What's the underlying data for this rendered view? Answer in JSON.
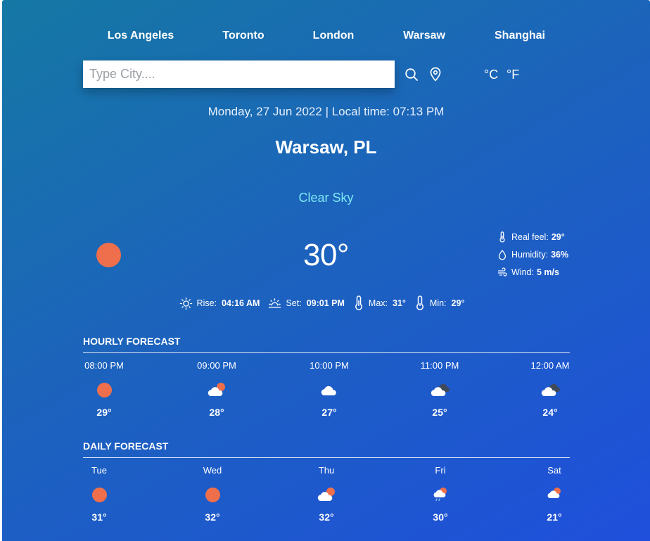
{
  "cities": [
    "Los Angeles",
    "Toronto",
    "London",
    "Warsaw",
    "Shanghai"
  ],
  "search": {
    "placeholder": "Type City....",
    "value": ""
  },
  "icons": {
    "search": "search-icon",
    "location": "location-pin-icon"
  },
  "units": {
    "celsius": "°C",
    "fahrenheit": "°F"
  },
  "datetime": "Monday, 27 Jun 2022 | Local time: 07:13 PM",
  "location": "Warsaw, PL",
  "condition": "Clear Sky",
  "current": {
    "temperature": "30°",
    "real_feel_label": "Real feel:",
    "real_feel": "29°",
    "humidity_label": "Humidity:",
    "humidity": "36%",
    "wind_label": "Wind:",
    "wind": "5 m/s"
  },
  "sun": {
    "rise_label": "Rise:",
    "rise": "04:16 AM",
    "set_label": "Set:",
    "set": "09:01 PM",
    "max_label": "Max:",
    "max": "31°",
    "min_label": "Min:",
    "min": "29°"
  },
  "hourly": {
    "title": "HOURLY FORECAST",
    "items": [
      {
        "time": "08:00 PM",
        "icon": "sun-icon",
        "temp": "29°"
      },
      {
        "time": "09:00 PM",
        "icon": "cloud-sun-icon",
        "temp": "28°"
      },
      {
        "time": "10:00 PM",
        "icon": "cloud-icon",
        "temp": "27°"
      },
      {
        "time": "11:00 PM",
        "icon": "cloud-dark-icon",
        "temp": "25°"
      },
      {
        "time": "12:00 AM",
        "icon": "cloud-dark-icon",
        "temp": "24°"
      }
    ]
  },
  "daily": {
    "title": "DAILY FORECAST",
    "items": [
      {
        "day": "Tue",
        "icon": "sun-icon",
        "temp": "31°"
      },
      {
        "day": "Wed",
        "icon": "sun-icon",
        "temp": "32°"
      },
      {
        "day": "Thu",
        "icon": "cloud-sun-icon",
        "temp": "32°"
      },
      {
        "day": "Fri",
        "icon": "rain-sun-icon",
        "temp": "30°"
      },
      {
        "day": "Sat",
        "icon": "cloud-sun-icon",
        "temp": "21°"
      }
    ]
  },
  "colors": {
    "sun": "#ef6f4c",
    "condition": "#7ee8f5",
    "bg_start": "#1578a4",
    "bg_end": "#1f4fdc"
  }
}
